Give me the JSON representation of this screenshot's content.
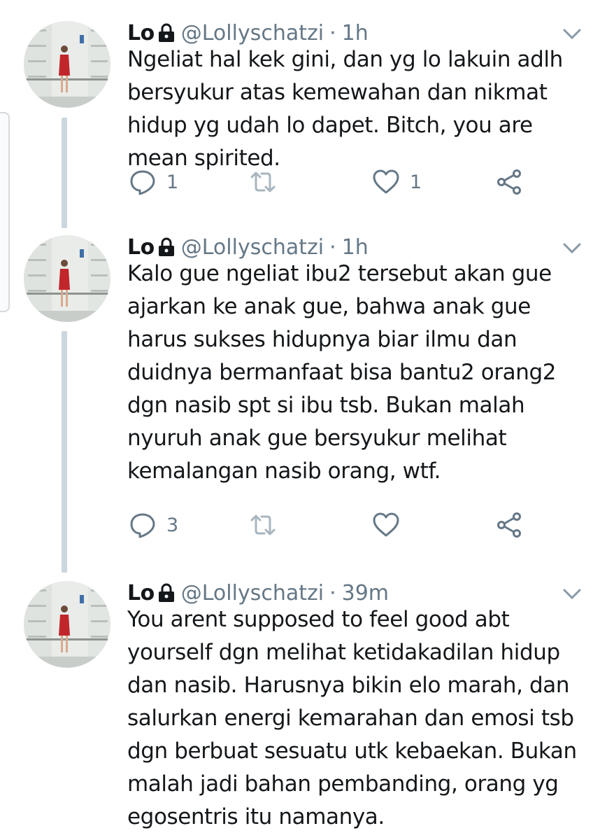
{
  "tweets": [
    {
      "name": "Lo",
      "handle": "@Lollyschatzi",
      "separator": "·",
      "time": "1h",
      "text": "Ngeliat hal kek gini, dan yg lo lakuin adlh bersyukur atas kemewahan dan nikmat hidup yg udah lo dapet. Bitch, you are mean spirited.",
      "reply_count": "1",
      "retweet_count": "",
      "like_count": "1"
    },
    {
      "name": "Lo",
      "handle": "@Lollyschatzi",
      "separator": "·",
      "time": "1h",
      "text": "Kalo gue ngeliat ibu2 tersebut akan gue ajarkan ke anak gue, bahwa anak gue harus sukses hidupnya biar ilmu dan duidnya bermanfaat bisa bantu2 orang2 dgn nasib spt si ibu tsb. Bukan malah nyuruh anak gue bersyukur melihat kemalangan nasib orang, wtf.",
      "reply_count": "3",
      "retweet_count": "",
      "like_count": ""
    },
    {
      "name": "Lo",
      "handle": "@Lollyschatzi",
      "separator": "·",
      "time": "39m",
      "text": "You arent supposed to feel good abt yourself dgn melihat ketidakadilan hidup dan nasib. Harusnya bikin elo marah, dan salurkan energi kemarahan dan emosi tsb dgn berbuat sesuatu utk kebaekan. Bukan malah jadi bahan pembanding, orang yg egosentris itu namanya.",
      "reply_count": "",
      "retweet_count": "",
      "like_count": ""
    }
  ],
  "icons": {
    "reply": "reply-icon",
    "retweet": "retweet-icon",
    "like": "heart-icon",
    "share": "share-icon",
    "protected": "lock-icon",
    "more": "chevron-down-icon"
  },
  "colors": {
    "text": "#14171a",
    "secondary": "#657786",
    "thread_line": "#ccd6dd"
  }
}
